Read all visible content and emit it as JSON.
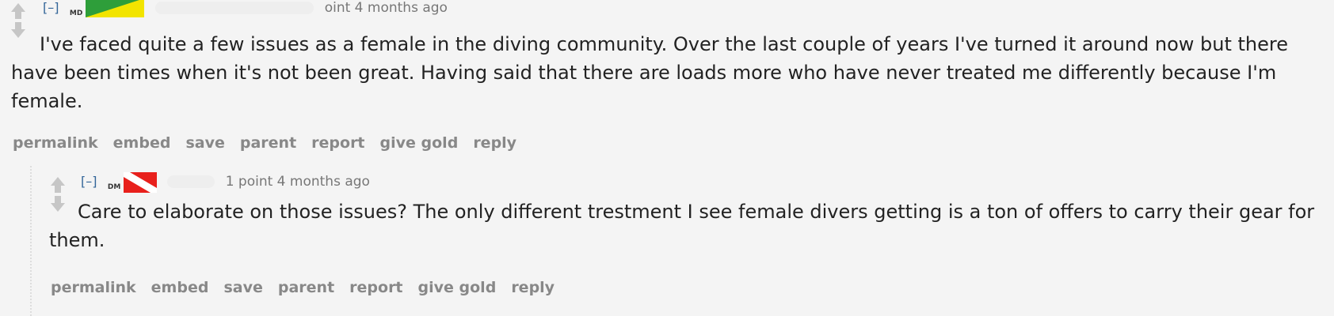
{
  "comments": [
    {
      "expand": "[–]",
      "flair": "MD",
      "meta": "oint 4 months ago",
      "body": "I've faced quite a few issues as a female in the diving community. Over the last couple of years I've turned it around now but there have been times when it's not been great. Having said that there are loads more who have never treated me differently because I'm female.",
      "buttons": [
        "permalink",
        "embed",
        "save",
        "parent",
        "report",
        "give gold",
        "reply"
      ]
    },
    {
      "expand": "[–]",
      "flair": "DM",
      "meta": "1 point 4 months ago",
      "body": "Care to elaborate on those issues? The only different trestment I see female divers getting is a ton of offers to carry their gear for them.",
      "buttons": [
        "permalink",
        "embed",
        "save",
        "parent",
        "report",
        "give gold",
        "reply"
      ]
    }
  ],
  "colors": {
    "background": "#f4f4f4",
    "link_blue": "#336699",
    "muted": "#888888",
    "text": "#222222",
    "flag_green": "#2e9e3a",
    "flag_yellow": "#f2e400",
    "flag_red": "#e8201c"
  },
  "icons": {
    "upvote": "upvote-arrow-icon",
    "downvote": "downvote-arrow-icon",
    "brazil_flag": "brazil-flag-icon",
    "dive_flag": "dive-flag-icon"
  }
}
